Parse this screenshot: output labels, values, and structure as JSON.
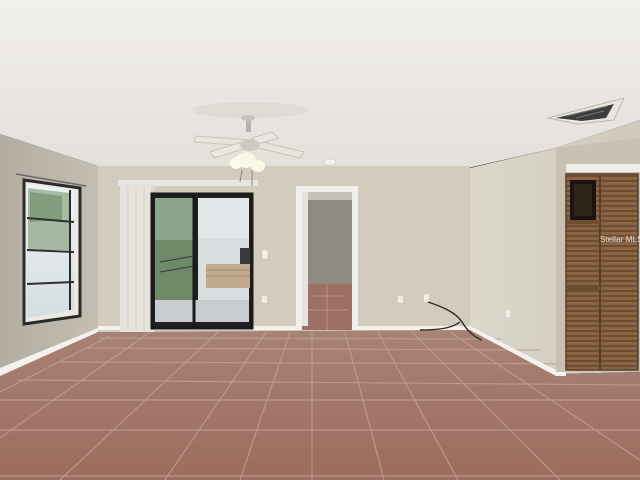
{
  "photo": {
    "watermark_text": "Stellar MLS",
    "colors": {
      "ceiling": "#eceae5",
      "wall_left": "#bdb8ad",
      "wall_back": "#d4cdc0",
      "wall_right": "#d9d4c8",
      "floor_tile": "#a57768",
      "grout": "#b99a8d",
      "baseboard": "#f5f3ee",
      "louver_door": "#8c6845",
      "window_sky": "#dfe8ea",
      "hallway_wall": "#a9a497",
      "hallway_floor": "#9b6f62"
    },
    "objects": [
      "ceiling-fan",
      "hvac-vent",
      "smoke-detector",
      "window",
      "sliding-glass-door",
      "vertical-blinds",
      "interior-doorway",
      "louvered-closet-door",
      "power-cable"
    ]
  }
}
